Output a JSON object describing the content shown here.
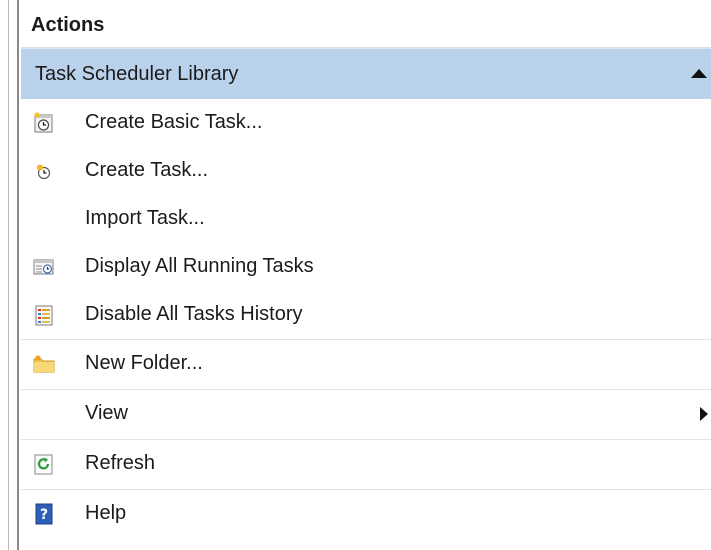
{
  "panel": {
    "title": "Actions",
    "section": {
      "label": "Task Scheduler Library"
    },
    "items": [
      {
        "label": "Create Basic Task...",
        "icon": "basic-task-icon"
      },
      {
        "label": "Create Task...",
        "icon": "create-task-icon"
      },
      {
        "label": "Import Task...",
        "icon": ""
      },
      {
        "label": "Display All Running Tasks",
        "icon": "running-tasks-icon"
      },
      {
        "label": "Disable All Tasks History",
        "icon": "history-icon"
      },
      {
        "label": "New Folder...",
        "icon": "new-folder-icon"
      },
      {
        "label": "View",
        "icon": ""
      },
      {
        "label": "Refresh",
        "icon": "refresh-icon"
      },
      {
        "label": "Help",
        "icon": "help-icon"
      }
    ]
  }
}
